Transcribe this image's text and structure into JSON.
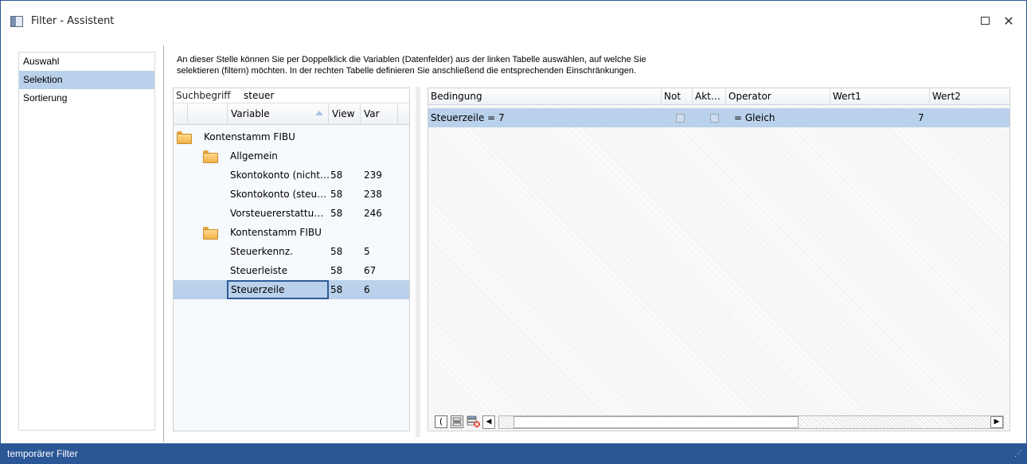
{
  "window": {
    "title": "Filter - Assistent",
    "maximize_glyph": "",
    "close_glyph": "✕"
  },
  "nav": {
    "items": [
      {
        "label": "Auswahl",
        "selected": false
      },
      {
        "label": "Selektion",
        "selected": true
      },
      {
        "label": "Sortierung",
        "selected": false
      }
    ]
  },
  "info": {
    "line1": "An dieser Stelle können Sie per Doppelklick die Variablen (Datenfelder) aus der linken Tabelle auswählen, auf welche Sie",
    "line2": "selektieren (filtern) möchten. In der rechten Tabelle definieren Sie anschließend die entsprechenden Einschränkungen."
  },
  "variables": {
    "search_label": "Suchbegriff",
    "search_value": "steuer",
    "columns": {
      "variable": "Variable",
      "view": "View",
      "var": "Var"
    },
    "rows": [
      {
        "label": "Kontenstamm FIBU",
        "view": "",
        "var": "",
        "level": 0,
        "folder": true
      },
      {
        "label": "Allgemein",
        "view": "",
        "var": "",
        "level": 1,
        "folder": true
      },
      {
        "label": "Skontokonto (nicht…",
        "view": "58",
        "var": "239",
        "level": 2,
        "folder": false
      },
      {
        "label": "Skontokonto (steu…",
        "view": "58",
        "var": "238",
        "level": 2,
        "folder": false
      },
      {
        "label": "Vorsteuererstattu…",
        "view": "58",
        "var": "246",
        "level": 2,
        "folder": false
      },
      {
        "label": "Kontenstamm FIBU",
        "view": "",
        "var": "",
        "level": 1,
        "folder": true
      },
      {
        "label": "Steuerkennz.",
        "view": "58",
        "var": "5",
        "level": 2,
        "folder": false
      },
      {
        "label": "Steuerleiste",
        "view": "58",
        "var": "67",
        "level": 2,
        "folder": false
      },
      {
        "label": "Steuerzeile",
        "view": "58",
        "var": "6",
        "level": 2,
        "folder": false,
        "selected": true
      }
    ]
  },
  "conditions": {
    "columns": {
      "bedingung": "Bedingung",
      "not": "Not",
      "akt": "Akt…",
      "operator": "Operator",
      "wert1": "Wert1",
      "wert2": "Wert2"
    },
    "rows": [
      {
        "bedingung": "Steuerzeile = 7",
        "operator": "= Gleich",
        "wert1": "7",
        "wert2": ""
      }
    ],
    "toolbar": {
      "paren_label": "(",
      "scroll_left": "◀",
      "scroll_right": "▶"
    }
  },
  "status": {
    "text": "temporärer Filter",
    "grip": "⋰"
  },
  "colors": {
    "accent": "#2b5797",
    "selection": "#b9d1ea"
  }
}
